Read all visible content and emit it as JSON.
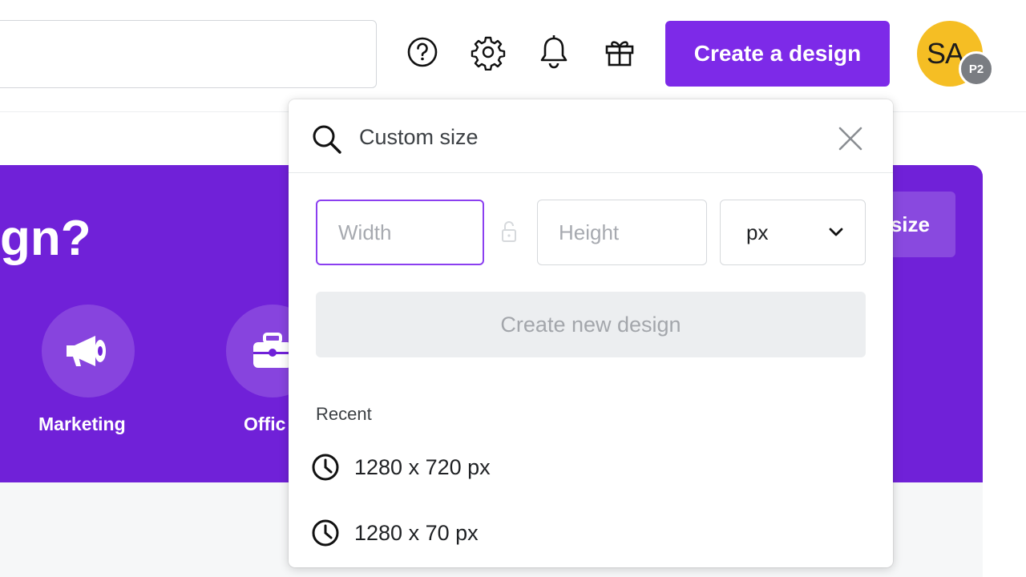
{
  "header": {
    "create_button_label": "Create a design",
    "icons": [
      "help-icon",
      "settings-gear-icon",
      "notification-bell-icon",
      "gift-icon"
    ],
    "avatar": {
      "initials": "SA",
      "badge": "P2",
      "color": "#f5be24"
    }
  },
  "hero": {
    "title_partial": "gn?",
    "custom_size_partial": "size",
    "categories": [
      {
        "label": "Marketing",
        "icon": "megaphone-icon"
      },
      {
        "label": "Offic",
        "icon": "briefcase-icon"
      }
    ],
    "color": "#7021d8"
  },
  "dropdown": {
    "search_value": "Custom size",
    "width_placeholder": "Width",
    "height_placeholder": "Height",
    "unit": "px",
    "create_new_label": "Create new design",
    "recent_label": "Recent",
    "recent_items": [
      "1280 x 720 px",
      "1280 x 70 px"
    ]
  },
  "colors": {
    "accent": "#7d2ae8",
    "disabled_bg": "#eceef0"
  }
}
